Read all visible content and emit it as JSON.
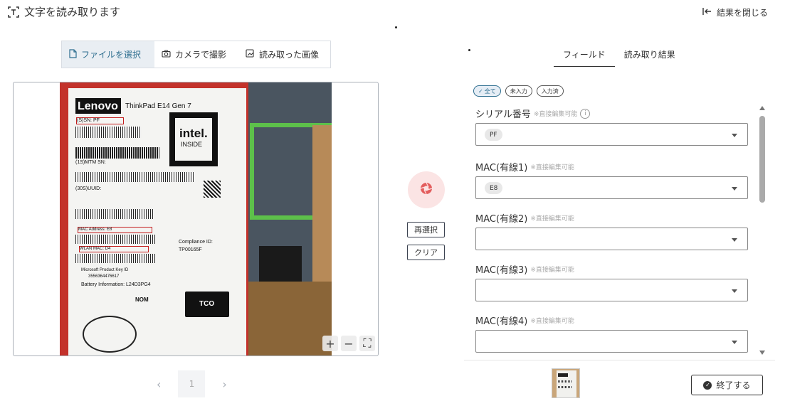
{
  "header": {
    "title": "文字を読み取ります",
    "scan_icon": "text-scan-icon",
    "close_results_label": "結果を閉じる",
    "close_icon": "arrow-left-bar-icon"
  },
  "source_tabs": [
    {
      "label": "ファイルを選択",
      "icon": "file-icon",
      "active": true
    },
    {
      "label": "カメラで撮影",
      "icon": "camera-icon",
      "active": false
    },
    {
      "label": "読み取った画像",
      "icon": "image-scan-icon",
      "active": false
    }
  ],
  "photo_label": {
    "brand": "Lenovo",
    "model": "ThinkPad E14 Gen 7",
    "sn": "(S)SN: PF",
    "mtm_sn": "(1S)MTM SN:",
    "uuid": "(30S)UUID:",
    "mac_address": "MAC Address: E8",
    "wlan_mac": "WLAN MAC: D4",
    "compliance_title": "Compliance ID:",
    "compliance_id": "TP00165F",
    "product_key_title": "Microsoft Product Key ID",
    "product_key": "3556364476617",
    "battery": "Battery Information: L24D3PG4",
    "intel_1": "intel.",
    "intel_2": "INSIDE",
    "nom": "NOM",
    "tco": "TCO"
  },
  "zoom_controls": {
    "zoom_in": "+",
    "zoom_out": "−",
    "fit": "⛶"
  },
  "pagination": {
    "current_page": "1",
    "prev": "‹",
    "next": "›"
  },
  "middle_actions": {
    "reselect": "再選択",
    "clear": "クリア"
  },
  "right_tabs": [
    {
      "label": "フィールド",
      "active": true
    },
    {
      "label": "読み取り結果",
      "active": false
    }
  ],
  "filters": [
    {
      "label": "全て",
      "active": true
    },
    {
      "label": "未入力",
      "active": false
    },
    {
      "label": "入力済",
      "active": false
    }
  ],
  "fields": [
    {
      "label": "シリアル番号",
      "note": "※直接編集可能",
      "has_info": true,
      "value": "PF"
    },
    {
      "label": "MAC(有線1)",
      "note": "※直接編集可能",
      "has_info": false,
      "value": "E8"
    },
    {
      "label": "MAC(有線2)",
      "note": "※直接編集可能",
      "has_info": false,
      "value": ""
    },
    {
      "label": "MAC(有線3)",
      "note": "※直接編集可能",
      "has_info": false,
      "value": ""
    },
    {
      "label": "MAC(有線4)",
      "note": "※直接編集可能",
      "has_info": false,
      "value": ""
    }
  ],
  "footer": {
    "finish_label": "終了する",
    "finish_icon": "check-circle-icon"
  },
  "colors": {
    "accent": "#2f6f90",
    "shutter_bg": "#fbe4e4",
    "shutter_icon": "#e35d5d",
    "label_red": "#c41e1e"
  }
}
